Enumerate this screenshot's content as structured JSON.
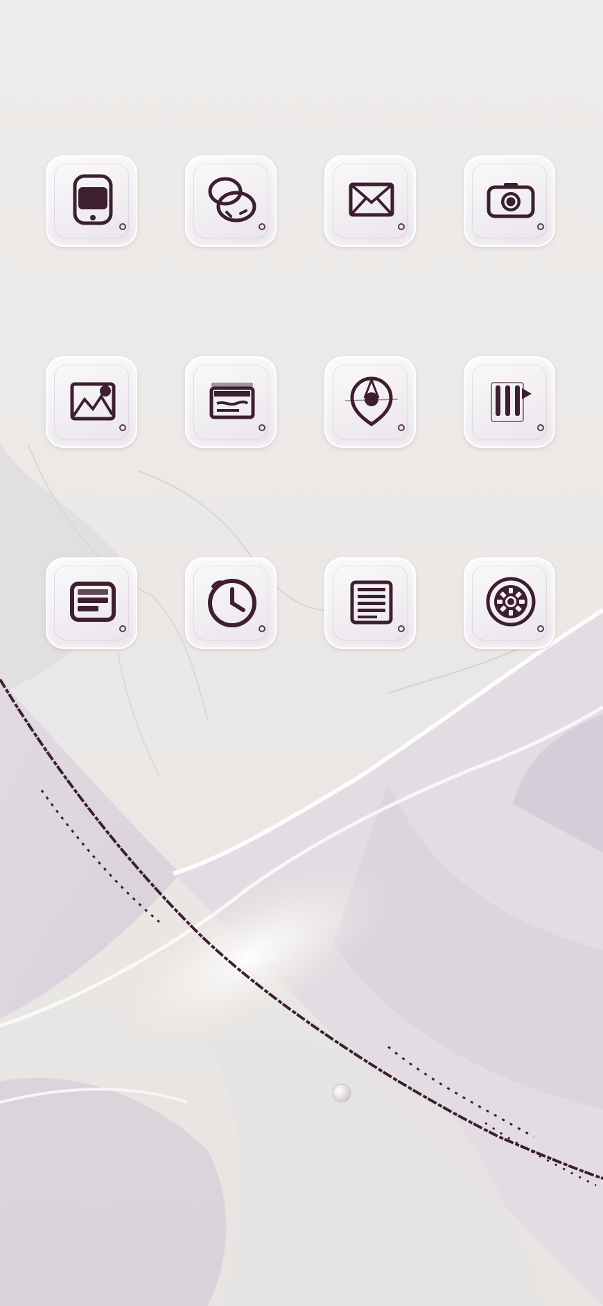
{
  "screen": {
    "background_color": "#ebe8e6",
    "accent_color": "#3d1f2e"
  },
  "apps": [
    {
      "icon": "phone-icon"
    },
    {
      "icon": "contacts-icon"
    },
    {
      "icon": "mail-icon"
    },
    {
      "icon": "camera-icon"
    },
    {
      "icon": "photos-icon"
    },
    {
      "icon": "wallet-icon"
    },
    {
      "icon": "maps-icon"
    },
    {
      "icon": "music-icon"
    },
    {
      "icon": "calendar-icon"
    },
    {
      "icon": "clock-icon"
    },
    {
      "icon": "notes-icon"
    },
    {
      "icon": "settings-icon"
    }
  ]
}
